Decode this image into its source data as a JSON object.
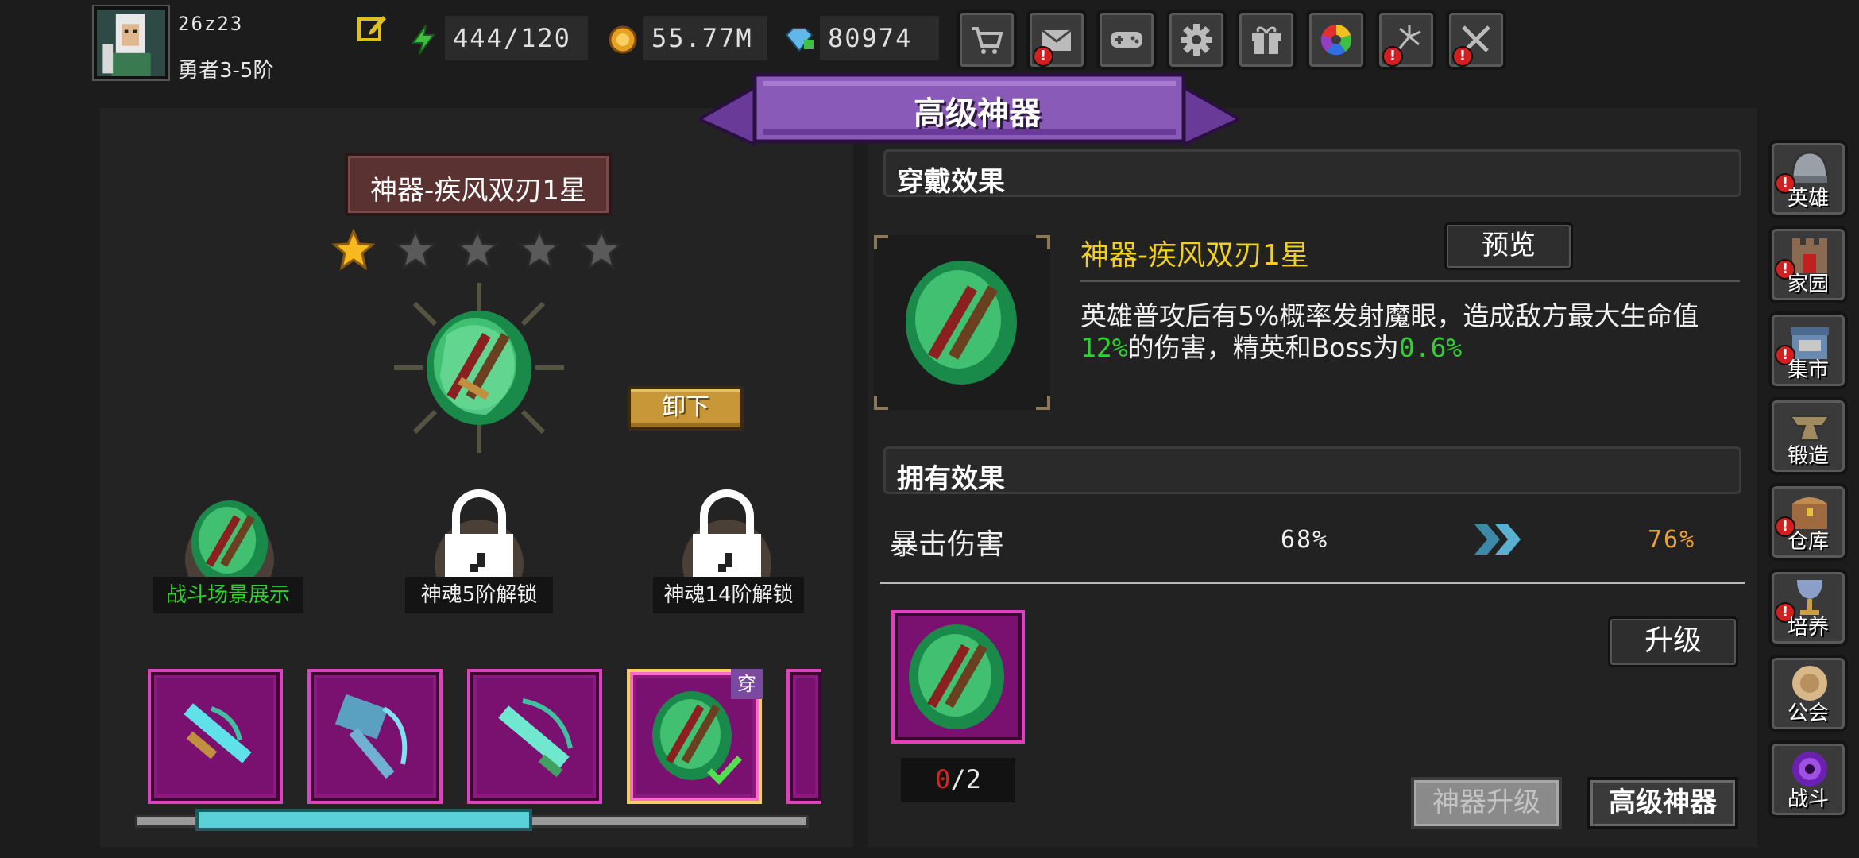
{
  "player": {
    "id": "26z23",
    "rank": "勇者3-5阶"
  },
  "resources": {
    "energy": "444/120",
    "gold": "55.77M",
    "gems": "80974"
  },
  "top_buttons": [
    {
      "icon": "cart-icon",
      "badge": false
    },
    {
      "icon": "mail-icon",
      "badge": true
    },
    {
      "icon": "gamepad-icon",
      "badge": false
    },
    {
      "icon": "gear-icon",
      "badge": false
    },
    {
      "icon": "gift-icon",
      "badge": false
    },
    {
      "icon": "color-wheel-icon",
      "badge": false
    },
    {
      "icon": "sparkle-icon",
      "badge": true
    },
    {
      "icon": "crossed-swords-icon",
      "badge": true
    }
  ],
  "badge_mark": "!",
  "banner": {
    "title": "高级神器"
  },
  "artifact": {
    "title": "神器-疾风双刃1星",
    "stars_filled": 1,
    "stars_total": 5,
    "unequip_label": "卸下"
  },
  "slots": [
    {
      "label": "战斗场景展示",
      "locked": false
    },
    {
      "label": "神魂5阶解锁",
      "locked": true
    },
    {
      "label": "神魂14阶解锁",
      "locked": true
    }
  ],
  "inventory": {
    "wear_tag": "穿",
    "equipped_index": 3,
    "scroll_fraction_start": 0.09,
    "scroll_fraction_end": 0.59
  },
  "wear_effect": {
    "section_title": "穿戴效果",
    "name": "神器-疾风双刃1星",
    "preview_label": "预览",
    "desc_part1": "英雄普攻后有5%概率发射魔眼，造成敌方最大生命值",
    "desc_value1": "12%",
    "desc_part2": "的伤害，精英和Boss为",
    "desc_value2": "0.6%"
  },
  "own_effect": {
    "section_title": "拥有效果",
    "stat_name": "暴击伤害",
    "stat_from": "68%",
    "stat_to": "76%"
  },
  "upgrade": {
    "count_current": "0",
    "count_sep": "/",
    "count_required": "2",
    "button_label": "升级"
  },
  "bottom_tabs": {
    "upgrade_tab": "神器升级",
    "advanced_tab": "高级神器"
  },
  "sidebar": [
    {
      "label": "英雄",
      "icon": "helmet-icon",
      "badge": true
    },
    {
      "label": "家园",
      "icon": "castle-icon",
      "badge": true
    },
    {
      "label": "集市",
      "icon": "shop-icon",
      "badge": true
    },
    {
      "label": "锻造",
      "icon": "anvil-icon",
      "badge": false
    },
    {
      "label": "仓库",
      "icon": "chest-icon",
      "badge": true
    },
    {
      "label": "培养",
      "icon": "goblet-icon",
      "badge": true
    },
    {
      "label": "公会",
      "icon": "guild-icon",
      "badge": false
    },
    {
      "label": "战斗",
      "icon": "portal-icon",
      "badge": false
    }
  ],
  "colors": {
    "banner_purple": "#8a5ab8",
    "highlight_green": "#30d030",
    "gold_text": "#f0d020",
    "orange_value": "#f0a030",
    "rarity_magenta": "#e040c0"
  }
}
